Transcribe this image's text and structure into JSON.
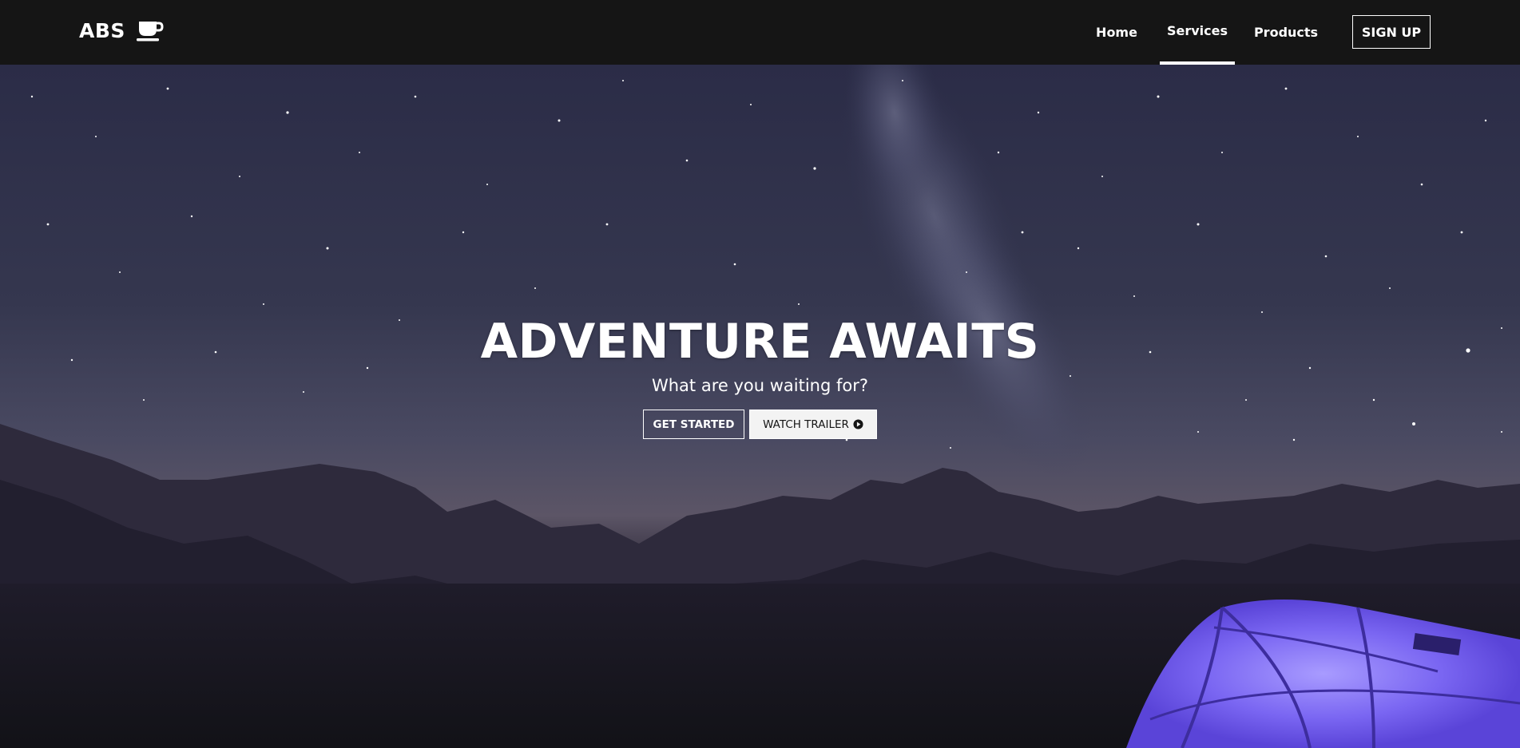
{
  "navbar": {
    "logo_text": "ABS",
    "logo_icon": "coffee-cup-icon",
    "links": [
      {
        "label": "Home",
        "active": false
      },
      {
        "label": "Services",
        "active": true
      },
      {
        "label": "Products",
        "active": false
      }
    ],
    "signup_label": "SIGN UP"
  },
  "hero": {
    "title": "ADVENTURE AWAITS",
    "subtitle": "What are you waiting for?",
    "primary_button_label": "GET STARTED",
    "secondary_button_label": "WATCH TRAILER",
    "secondary_button_icon": "play-circle-icon",
    "background": "night-sky-mountains-tent-image"
  },
  "colors": {
    "navbar_bg": "#151515",
    "text": "#ffffff",
    "tent": "#7060f0"
  }
}
